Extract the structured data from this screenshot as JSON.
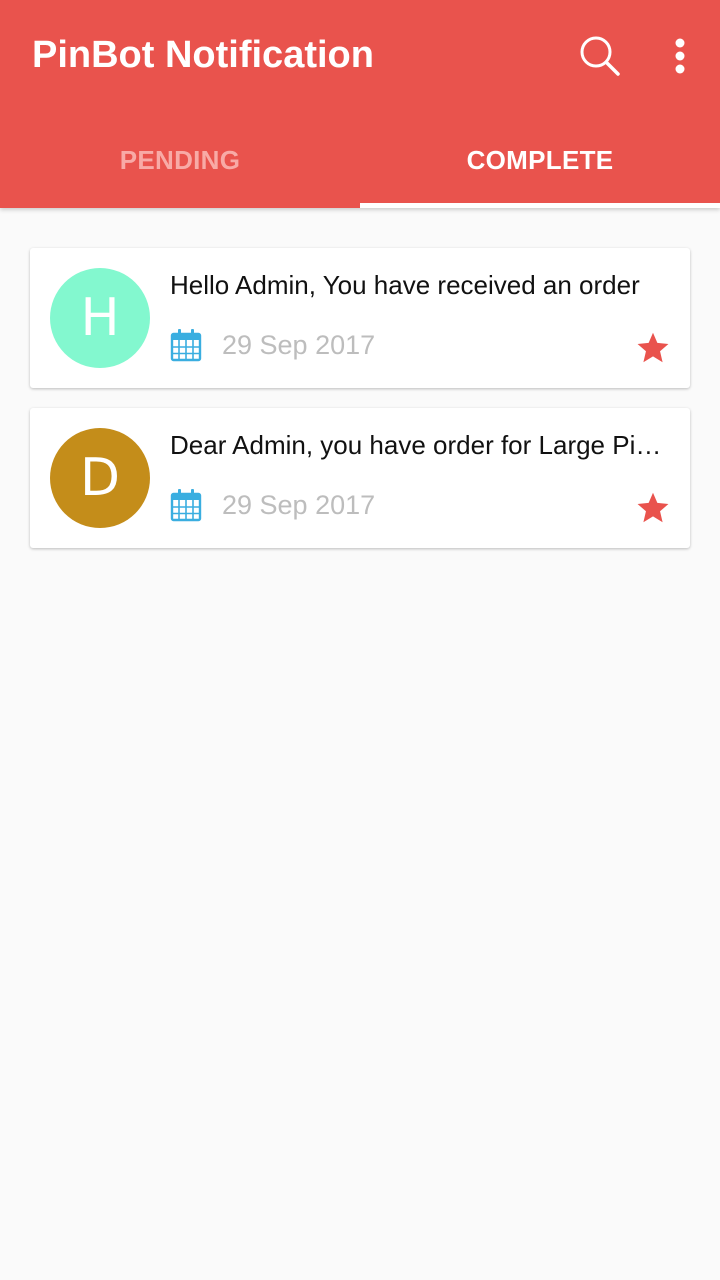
{
  "app": {
    "title": "PinBot Notification",
    "icons": {
      "search": "search-icon",
      "more": "more-vert-icon"
    }
  },
  "tabs": [
    {
      "label": "PENDING",
      "selected": false
    },
    {
      "label": "COMPLETE",
      "selected": true
    }
  ],
  "notifications": [
    {
      "initial": "H",
      "avatar_color": "#83f8cf",
      "message": "Hello Admin, You have received an order",
      "date": "29 Sep 2017",
      "starred": true
    },
    {
      "initial": "D",
      "avatar_color": "#c48d1a",
      "message": "Dear Admin, you have order for Large Pizza",
      "date": "29 Sep 2017",
      "starred": true
    }
  ],
  "colors": {
    "primary": "#e9534d",
    "star": "#e9534d",
    "calendar": "#3aaee0",
    "date_text": "#bdbdbd",
    "background": "#fafafa"
  }
}
